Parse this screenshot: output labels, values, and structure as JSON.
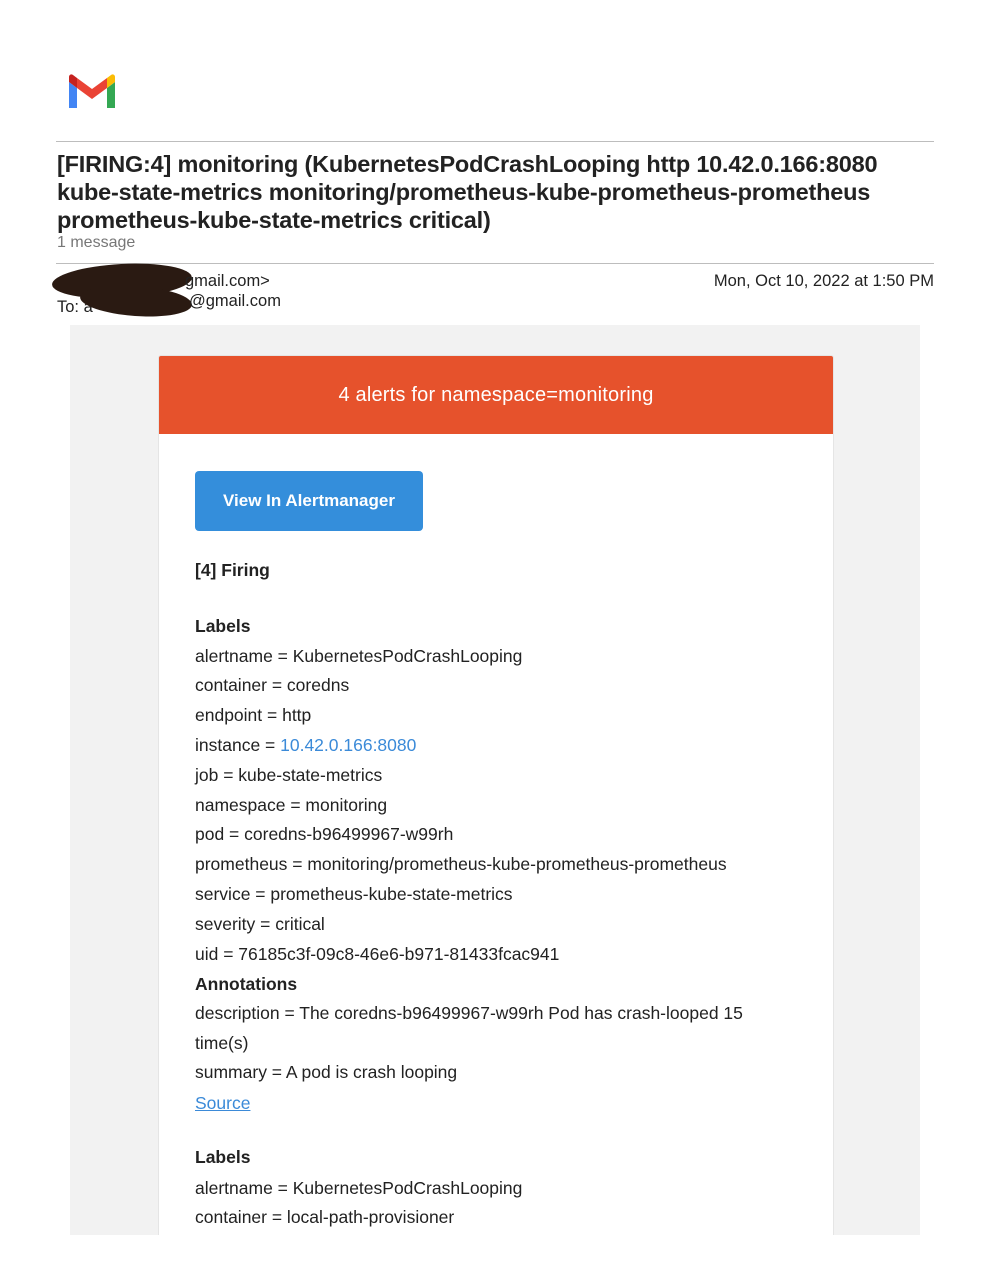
{
  "email": {
    "subject": "[FIRING:4] monitoring (KubernetesPodCrashLooping http 10.42.0.166:8080 kube-state-metrics monitoring/prometheus-kube-prometheus-prometheus prometheus-kube-state-metrics critical)",
    "message_count": "1 message",
    "from_suffix": "gmail.com>",
    "to_prefix": "To: a",
    "to_suffix": "@gmail.com",
    "date": "Mon, Oct 10, 2022 at 1:50 PM"
  },
  "alert": {
    "banner": "4 alerts for namespace=monitoring",
    "button": "View In Alertmanager",
    "firing_heading": "[4] Firing",
    "labels_heading": "Labels",
    "annotations_heading": "Annotations",
    "source_link": "Source",
    "label1": {
      "alertname": "alertname = KubernetesPodCrashLooping",
      "container": "container = coredns",
      "endpoint": "endpoint = http",
      "instance_prefix": "instance = ",
      "instance_value": "10.42.0.166:8080",
      "job": "job = kube-state-metrics",
      "namespace": "namespace = monitoring",
      "pod": "pod = coredns-b96499967-w99rh",
      "prometheus": "prometheus = monitoring/prometheus-kube-prometheus-prometheus",
      "service": "service = prometheus-kube-state-metrics",
      "severity": "severity = critical",
      "uid": "uid = 76185c3f-09c8-46e6-b971-81433fcac941"
    },
    "annotations1": {
      "description_line1": "description = The coredns-b96499967-w99rh Pod has crash-looped 15",
      "description_line2": "time(s)",
      "summary": "summary = A pod is crash looping"
    },
    "label2": {
      "alertname": "alertname = KubernetesPodCrashLooping",
      "container": "container = local-path-provisioner"
    }
  }
}
